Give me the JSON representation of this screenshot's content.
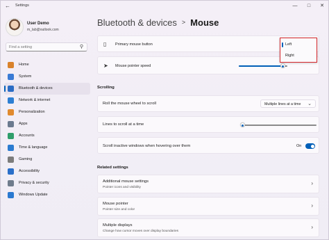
{
  "window": {
    "title": "Settings",
    "back_icon": "back-arrow-icon",
    "min_glyph": "—",
    "max_glyph": "□",
    "close_glyph": "✕"
  },
  "user": {
    "name": "User Demo",
    "email": "m_lab@outlook.com"
  },
  "search": {
    "placeholder": "Find a setting",
    "icon": "search-icon"
  },
  "sidebar": {
    "items": [
      {
        "label": "Home",
        "icon": "home-icon",
        "color": "#d9822b"
      },
      {
        "label": "System",
        "icon": "system-icon",
        "color": "#3a7bd5"
      },
      {
        "label": "Bluetooth & devices",
        "icon": "bluetooth-icon",
        "color": "#2b6cc4",
        "active": true
      },
      {
        "label": "Network & internet",
        "icon": "network-icon",
        "color": "#2d7fd3"
      },
      {
        "label": "Personalization",
        "icon": "personalization-icon",
        "color": "#e08a2e"
      },
      {
        "label": "Apps",
        "icon": "apps-icon",
        "color": "#6b7a8f"
      },
      {
        "label": "Accounts",
        "icon": "accounts-icon",
        "color": "#2f9e6b"
      },
      {
        "label": "Time & language",
        "icon": "time-language-icon",
        "color": "#2b7bd0"
      },
      {
        "label": "Gaming",
        "icon": "gaming-icon",
        "color": "#7c7c7c"
      },
      {
        "label": "Accessibility",
        "icon": "accessibility-icon",
        "color": "#2a6fc9"
      },
      {
        "label": "Privacy & security",
        "icon": "shield-icon",
        "color": "#6f7c8c"
      },
      {
        "label": "Windows Update",
        "icon": "windows-update-icon",
        "color": "#2a79d0"
      }
    ]
  },
  "breadcrumb": {
    "parent": "Bluetooth & devices",
    "separator": ">",
    "current": "Mouse"
  },
  "settings": {
    "primary_button": {
      "label": "Primary mouse button",
      "icon": "mouse-icon"
    },
    "pointer_speed": {
      "label": "Mouse pointer speed",
      "icon": "pointer-icon",
      "level": 0.9
    },
    "scrolling_header": "Scrolling",
    "roll_wheel": {
      "label": "Roll the mouse wheel to scroll",
      "value": "Multiple lines at a time"
    },
    "lines_to_scroll": {
      "label": "Lines to scroll at a time",
      "level": 0.03
    },
    "scroll_inactive": {
      "label": "Scroll inactive windows when hovering over them",
      "state": "On"
    },
    "related_header": "Related settings",
    "related": [
      {
        "title": "Additional mouse settings",
        "subtitle": "Pointer icons and visibility"
      },
      {
        "title": "Mouse pointer",
        "subtitle": "Pointer size and color"
      },
      {
        "title": "Multiple displays",
        "subtitle": "Change how cursor moves over display boundaries"
      }
    ]
  },
  "popup": {
    "options": [
      "Left",
      "Right"
    ],
    "selected": "Left"
  },
  "colors": {
    "accent": "#005fb8",
    "highlight_border": "#d6262b"
  }
}
